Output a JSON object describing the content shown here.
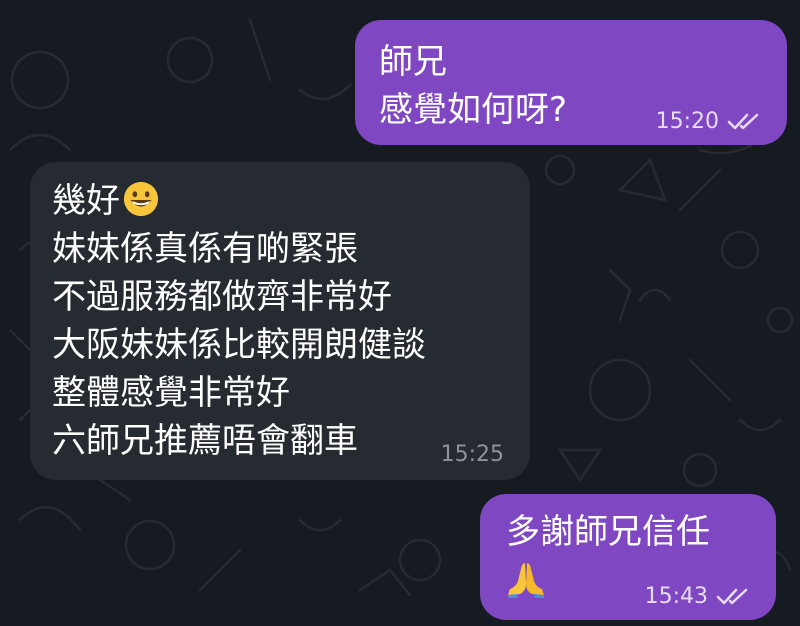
{
  "messages": [
    {
      "direction": "outgoing",
      "lines": [
        "師兄",
        "感覺如何呀?"
      ],
      "time": "15:20",
      "status_icon": "double-check-icon"
    },
    {
      "direction": "incoming",
      "lines": [
        "幾好",
        "妹妹係真係有啲緊張",
        "不過服務都做齊非常好",
        "大阪妹妹係比較開朗健談",
        "整體感覺非常好",
        "六師兄推薦唔會翻車"
      ],
      "emoji_after_first_line": "grinning-face-emoji",
      "time": "15:25"
    },
    {
      "direction": "outgoing",
      "lines": [
        "多謝師兄信任"
      ],
      "emoji_line": "folded-hands-emoji",
      "time": "15:43",
      "status_icon": "double-check-icon"
    }
  ],
  "colors": {
    "background": "#161a21",
    "outgoing_bubble": "#7f47c2",
    "incoming_bubble": "#262a31",
    "text": "#ffffff"
  }
}
